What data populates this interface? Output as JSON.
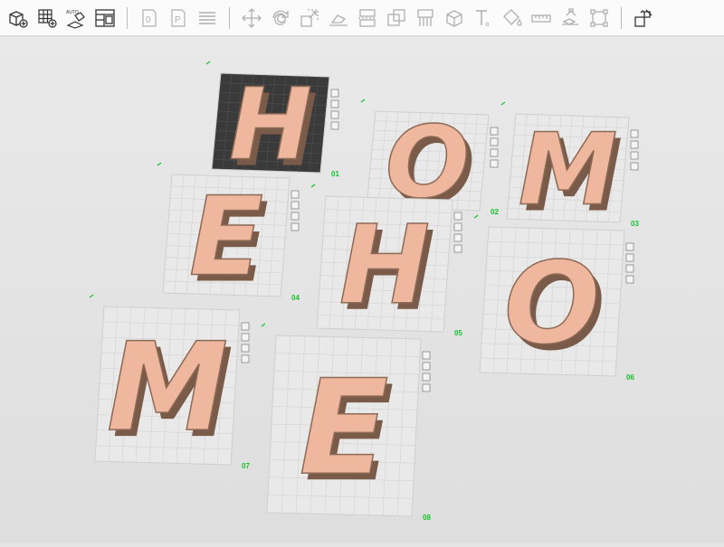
{
  "toolbar": {
    "tools": [
      {
        "name": "add-model-icon"
      },
      {
        "name": "arrange-grid-icon"
      },
      {
        "name": "auto-orient-icon",
        "label": "AUTO"
      },
      {
        "name": "split-plates-icon"
      },
      {
        "name": "plate-o-icon"
      },
      {
        "name": "plate-p-icon"
      },
      {
        "name": "layers-icon"
      },
      {
        "name": "move-icon"
      },
      {
        "name": "rotate-icon"
      },
      {
        "name": "scale-icon"
      },
      {
        "name": "lay-flat-icon"
      },
      {
        "name": "cut-icon"
      },
      {
        "name": "boolean-icon"
      },
      {
        "name": "support-paint-icon"
      },
      {
        "name": "cube-icon"
      },
      {
        "name": "text-icon"
      },
      {
        "name": "paint-bucket-icon"
      },
      {
        "name": "measure-icon"
      },
      {
        "name": "assembly-icon"
      },
      {
        "name": "bounding-box-icon"
      },
      {
        "name": "explode-icon"
      }
    ]
  },
  "colors": {
    "model": "#efb79d",
    "model_dark": "#7a5a48",
    "plate": "#e9e9e9",
    "grid": "#cfcfcf",
    "number": "#16c22e"
  },
  "plates": [
    {
      "number": "01",
      "letter": "H",
      "active": true
    },
    {
      "number": "02",
      "letter": "O",
      "active": false
    },
    {
      "number": "03",
      "letter": "M",
      "active": false
    },
    {
      "number": "04",
      "letter": "E",
      "active": false
    },
    {
      "number": "05",
      "letter": "H",
      "active": false
    },
    {
      "number": "06",
      "letter": "O",
      "active": false
    },
    {
      "number": "07",
      "letter": "M",
      "active": false
    },
    {
      "number": "08",
      "letter": "E",
      "active": false
    }
  ]
}
